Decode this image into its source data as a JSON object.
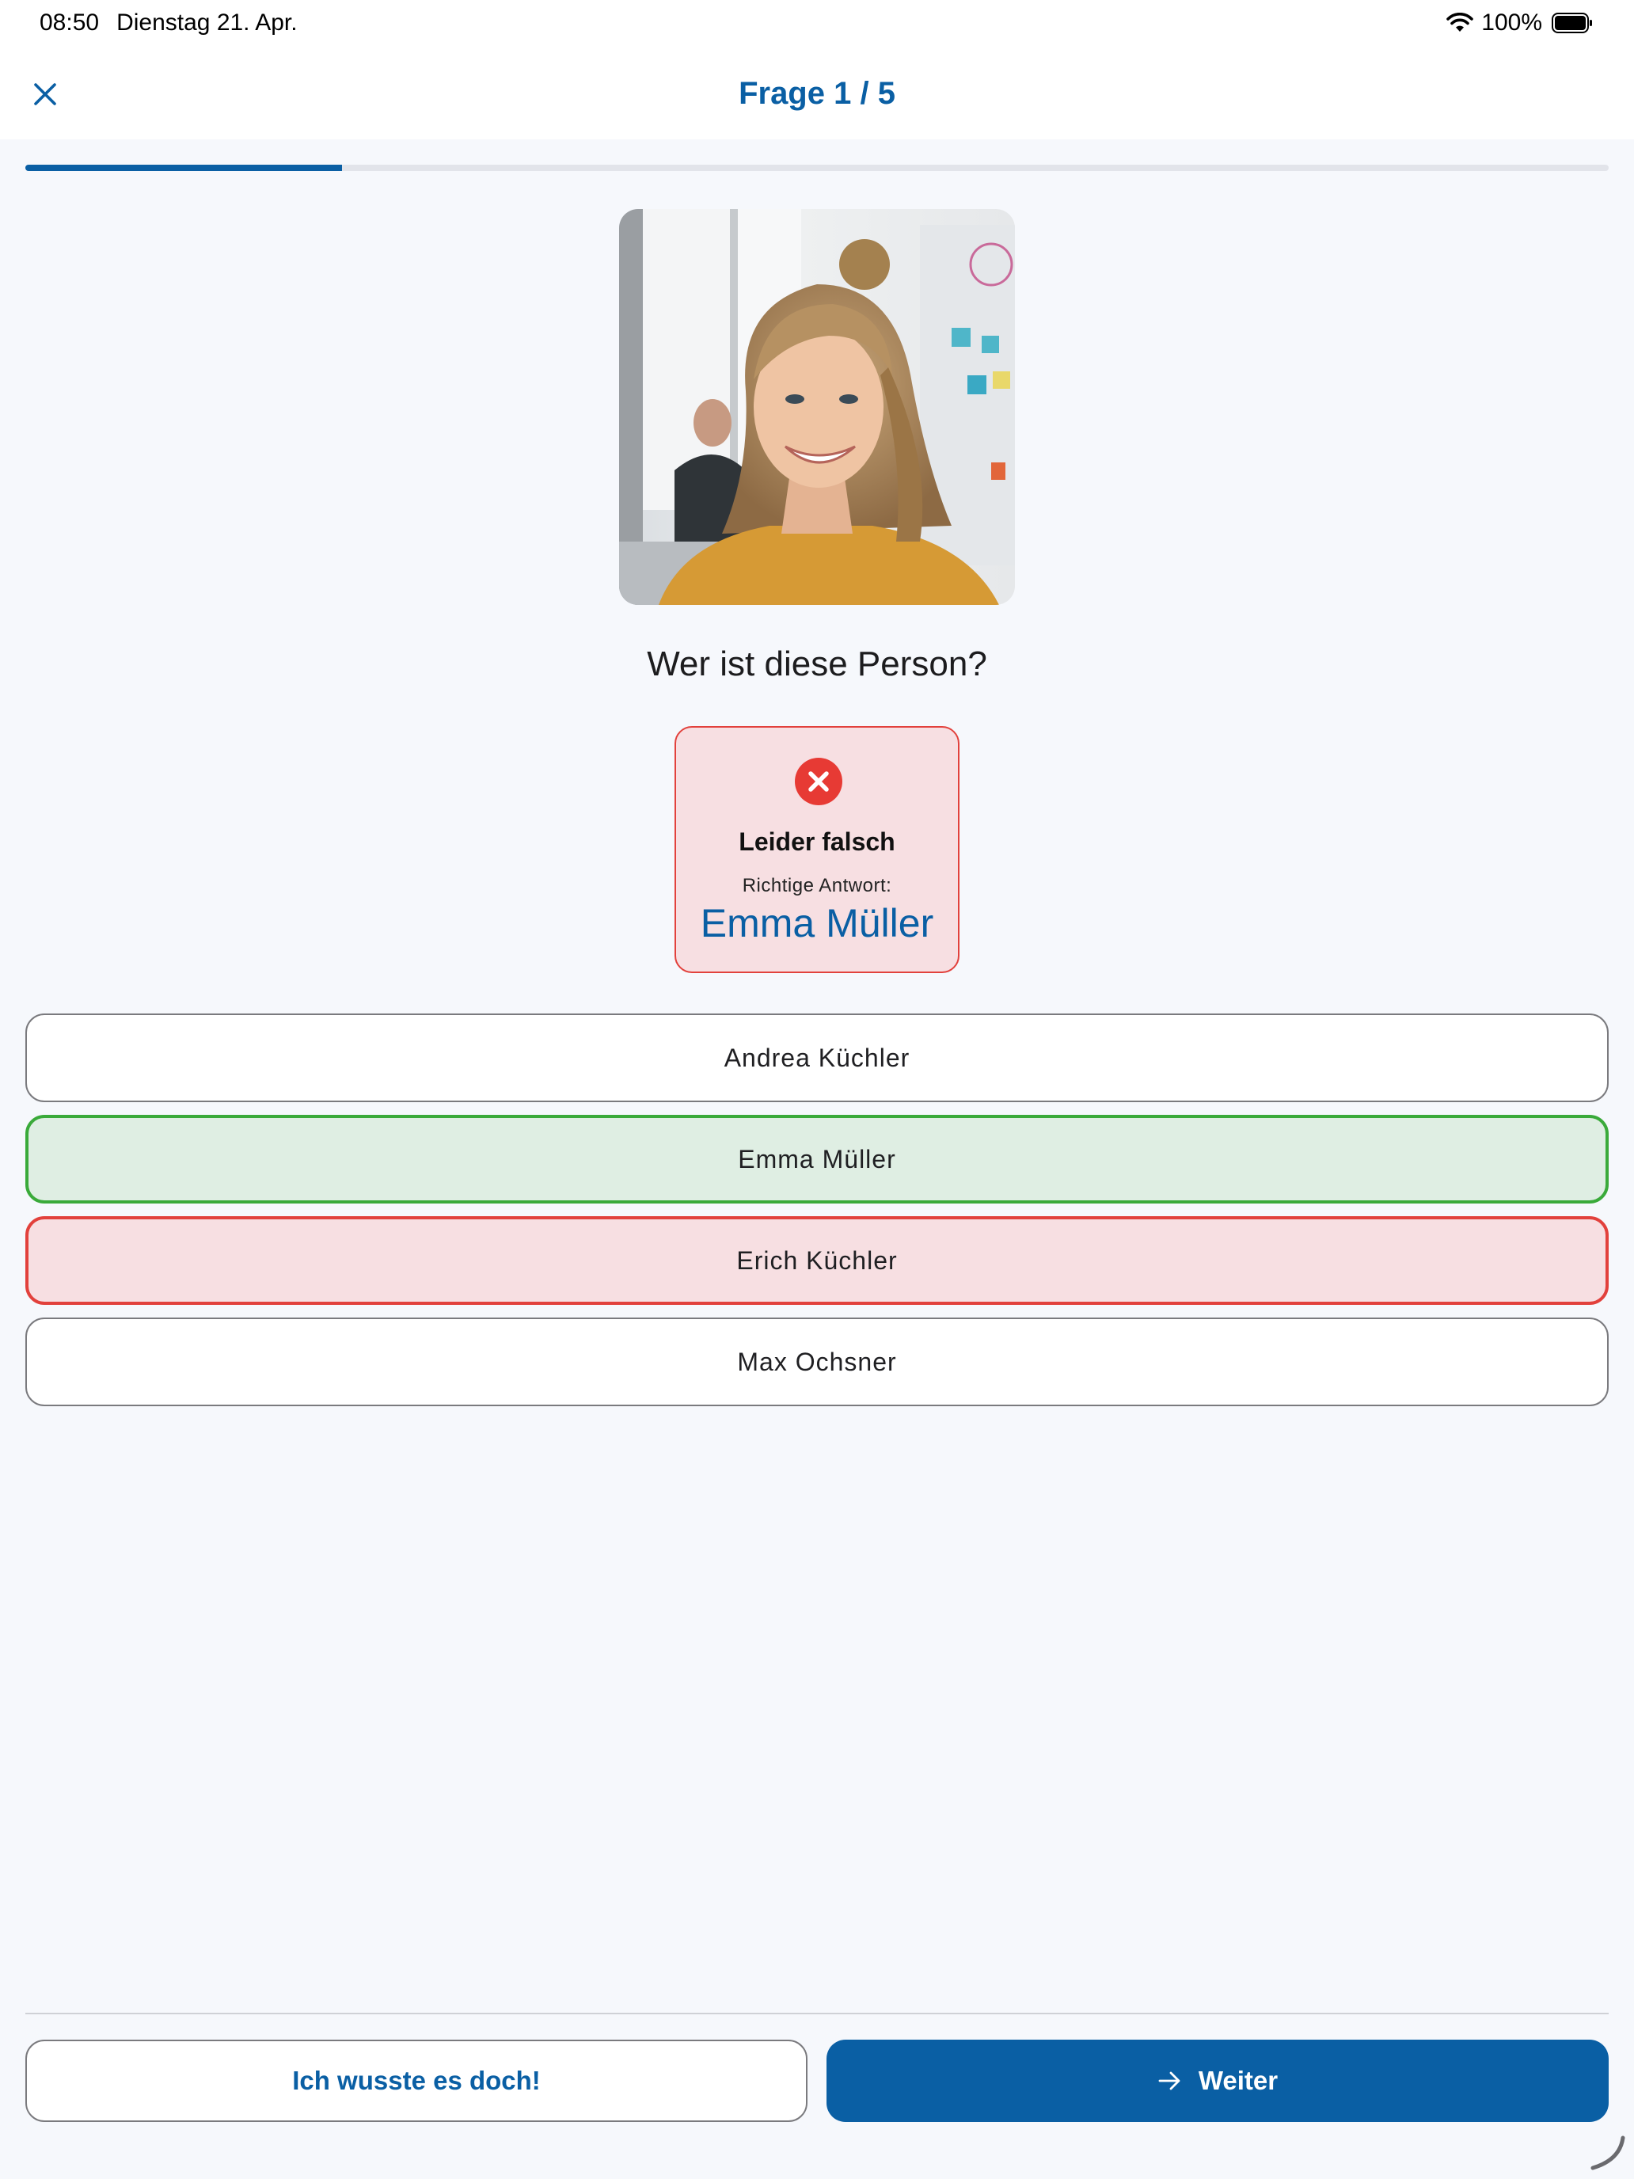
{
  "status_bar": {
    "time": "08:50",
    "date": "Dienstag 21. Apr.",
    "battery": "100%",
    "icons": [
      "wifi-icon",
      "battery-icon"
    ]
  },
  "header": {
    "title": "Frage 1 / 5",
    "close_icon": "close-icon"
  },
  "progress": {
    "current": 1,
    "total": 5,
    "fraction": 0.2
  },
  "question": {
    "text": "Wer ist diese Person?"
  },
  "feedback": {
    "icon": "error-x-icon",
    "title": "Leider falsch",
    "subtitle": "Richtige Antwort:",
    "answer": "Emma Müller"
  },
  "options": [
    {
      "label": "Andrea Küchler",
      "state": "neutral"
    },
    {
      "label": "Emma Müller",
      "state": "correct"
    },
    {
      "label": "Erich Küchler",
      "state": "wrong"
    },
    {
      "label": "Max Ochsner",
      "state": "neutral"
    }
  ],
  "footer": {
    "secondary_label": "Ich wusste es doch!",
    "primary_label": "Weiter",
    "primary_icon": "arrow-right-icon"
  },
  "colors": {
    "accent": "#0a5fa4",
    "correct_border": "#3aaa3a",
    "correct_bg": "#dfeee3",
    "wrong_border": "#e2413c",
    "wrong_bg": "#f7dfe2",
    "background": "#f6f8fc"
  }
}
